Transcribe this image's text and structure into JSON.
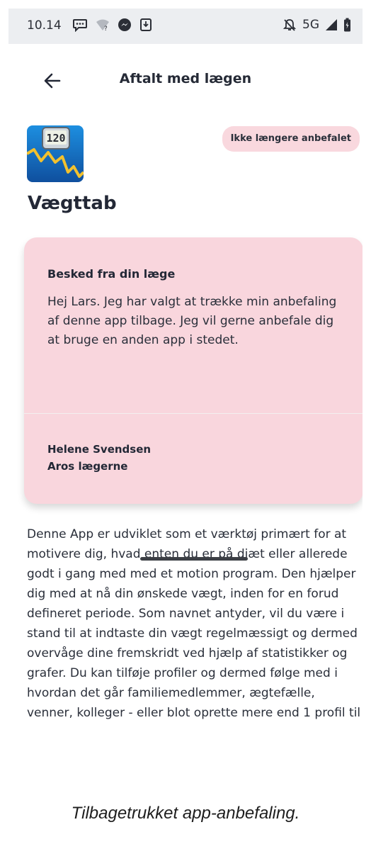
{
  "status_bar": {
    "time": "10.14",
    "network": "5G",
    "icons_left": [
      "message-icon",
      "wifi-unknown-icon",
      "messenger-icon",
      "download-icon"
    ],
    "icons_right": [
      "mute-icon",
      "signal-icon",
      "battery-icon"
    ]
  },
  "header": {
    "title": "Aftalt med lægen"
  },
  "app": {
    "icon_display_value": "120",
    "name": "Vægttab",
    "badge": "Ikke længere anbefalet"
  },
  "message": {
    "heading": "Besked fra din læge",
    "body": "Hej Lars. Jeg har valgt at trække min anbefaling af denne app tilbage. Jeg vil gerne anbefale dig at bruge en anden app i stedet.",
    "sender_name": "Helene Svendsen",
    "sender_clinic": "Aros lægerne"
  },
  "description": "Denne App er udviklet som et værktøj primært for at motivere dig, hvad enten du er på diæt eller allerede godt i gang med med et motion program. Den hjælper dig med at nå din ønskede vægt, inden for en forud defineret periode. Som navnet antyder, vil du være i stand til at indtaste din vægt regelmæssigt og dermed overvåge dine fremskridt ved hjælp af statistikker og grafer. Du kan tilføje profiler og dermed følge med i hvordan det går familiemedlemmer, ægtefælle, venner, kolleger - eller blot oprette mere end 1 profil til",
  "caption": "Tilbagetrukket app-anbefaling.",
  "colors": {
    "badge_bg": "#f9d8de",
    "card_bg": "#f9d6dd",
    "status_bar_bg": "#eceef1",
    "text": "#232836"
  }
}
